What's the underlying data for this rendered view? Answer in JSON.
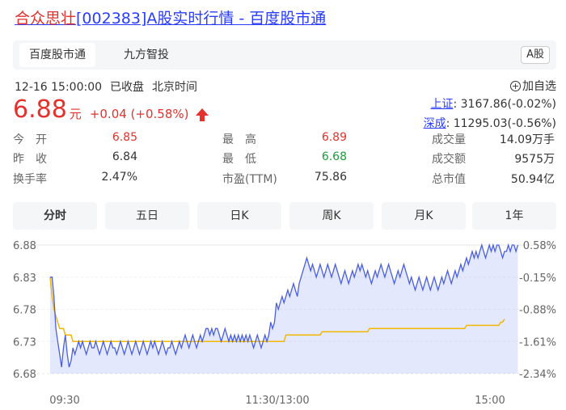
{
  "title": {
    "name": "合众思壮",
    "rest": "[002383]A股实时行情 - 百度股市通"
  },
  "tabs": {
    "t1": "百度股市通",
    "t2": "九方智投",
    "badge": "A股"
  },
  "status": {
    "datetime": "12-16 15:00:00",
    "state": "已收盘",
    "tz": "北京时间"
  },
  "add_fav": "加自选",
  "price": {
    "last": "6.88",
    "unit": "元",
    "change": "+0.04 (+0.58%)"
  },
  "indices": [
    {
      "name": "上证",
      "value": ": 3167.86(-0.02%)"
    },
    {
      "name": "深成",
      "value": ": 11295.03(-0.56%)"
    }
  ],
  "stats": [
    [
      {
        "label": "今　开",
        "value": "6.85"
      },
      {
        "label": "最　高",
        "value": "6.89"
      },
      {
        "label": "成交量",
        "value": "14.09万手"
      }
    ],
    [
      {
        "label": "昨　收",
        "value": "6.84"
      },
      {
        "label": "最　低",
        "value": "6.68"
      },
      {
        "label": "成交额",
        "value": "9575万"
      }
    ],
    [
      {
        "label": "换手率",
        "value": "2.47%"
      },
      {
        "label": "市盈(TTM)",
        "value": "75.86"
      },
      {
        "label": "总市值",
        "value": "50.94亿"
      }
    ]
  ],
  "period_tabs": [
    "分时",
    "五日",
    "日K",
    "周K",
    "月K",
    "1年"
  ],
  "colors": {
    "up": "#e4312c",
    "down": "#1b9c3a",
    "link": "#2a3cff",
    "price_line": "#4a5fe0",
    "avg_line": "#f2b705"
  },
  "chart_data": {
    "type": "line",
    "y_left_ticks": [
      "6.88",
      "6.83",
      "6.78",
      "6.73",
      "6.68"
    ],
    "y_right_ticks": [
      "0.58%",
      "-0.15%",
      "-0.88%",
      "-1.61%",
      "-2.34%"
    ],
    "x_ticks": [
      "09:30",
      "11:30/13:00",
      "15:00"
    ],
    "ylim": [
      6.68,
      6.88
    ],
    "x_points": 240,
    "series": [
      {
        "values": [
          6.83,
          6.83,
          6.8,
          6.75,
          6.73,
          6.71,
          6.69,
          6.72,
          6.74,
          6.71,
          6.69,
          6.7,
          6.72,
          6.71,
          6.72,
          6.73,
          6.72,
          6.73,
          6.72,
          6.71,
          6.72,
          6.73,
          6.72,
          6.72,
          6.73,
          6.72,
          6.71,
          6.72,
          6.73,
          6.72,
          6.71,
          6.72,
          6.73,
          6.72,
          6.72,
          6.71,
          6.72,
          6.73,
          6.72,
          6.71,
          6.72,
          6.73,
          6.72,
          6.71,
          6.72,
          6.73,
          6.72,
          6.71,
          6.72,
          6.73,
          6.72,
          6.71,
          6.72,
          6.73,
          6.72,
          6.73,
          6.72,
          6.71,
          6.72,
          6.73,
          6.72,
          6.71,
          6.72,
          6.72,
          6.73,
          6.72,
          6.71,
          6.72,
          6.73,
          6.72,
          6.73,
          6.74,
          6.73,
          6.72,
          6.73,
          6.74,
          6.73,
          6.72,
          6.73,
          6.74,
          6.73,
          6.74,
          6.75,
          6.75,
          6.74,
          6.75,
          6.74,
          6.75,
          6.75,
          6.74,
          6.73,
          6.74,
          6.75,
          6.74,
          6.73,
          6.74,
          6.73,
          6.74,
          6.73,
          6.74,
          6.73,
          6.74,
          6.73,
          6.74,
          6.73,
          6.74,
          6.73,
          6.72,
          6.73,
          6.74,
          6.73,
          6.72,
          6.73,
          6.74,
          6.73,
          6.74,
          6.76,
          6.75,
          6.76,
          6.79,
          6.78,
          6.79,
          6.8,
          6.79,
          6.8,
          6.81,
          6.8,
          6.81,
          6.82,
          6.81,
          6.8,
          6.82,
          6.83,
          6.84,
          6.85,
          6.86,
          6.85,
          6.84,
          6.85,
          6.84,
          6.83,
          6.84,
          6.85,
          6.84,
          6.83,
          6.84,
          6.85,
          6.84,
          6.83,
          6.84,
          6.85,
          6.84,
          6.83,
          6.82,
          6.83,
          6.84,
          6.83,
          6.82,
          6.83,
          6.84,
          6.83,
          6.84,
          6.85,
          6.84,
          6.85,
          6.84,
          6.83,
          6.84,
          6.83,
          6.82,
          6.83,
          6.84,
          6.83,
          6.84,
          6.85,
          6.84,
          6.83,
          6.84,
          6.85,
          6.84,
          6.83,
          6.82,
          6.83,
          6.84,
          6.83,
          6.84,
          6.85,
          6.84,
          6.83,
          6.82,
          6.83,
          6.82,
          6.81,
          6.82,
          6.83,
          6.82,
          6.81,
          6.82,
          6.83,
          6.82,
          6.81,
          6.82,
          6.83,
          6.82,
          6.81,
          6.82,
          6.83,
          6.82,
          6.83,
          6.84,
          6.83,
          6.82,
          6.83,
          6.84,
          6.83,
          6.84,
          6.85,
          6.84,
          6.85,
          6.86,
          6.85,
          6.86,
          6.87,
          6.86,
          6.87,
          6.86,
          6.87,
          6.88,
          6.87,
          6.86,
          6.87,
          6.88,
          6.87,
          6.88,
          6.87,
          6.88,
          6.88,
          6.87,
          6.86,
          6.87,
          6.87,
          6.88,
          6.87,
          6.88,
          6.88,
          6.87,
          6.88
        ]
      },
      {
        "values": [
          6.83,
          6.8,
          6.78,
          6.77,
          6.76,
          6.75,
          6.75,
          6.75,
          6.74,
          6.74,
          6.74,
          6.74,
          6.73,
          6.73,
          6.73,
          6.73,
          6.73,
          6.73,
          6.73,
          6.73,
          6.73,
          6.73,
          6.73,
          6.73,
          6.73,
          6.73,
          6.73,
          6.73,
          6.73,
          6.73,
          6.73,
          6.73,
          6.73,
          6.73,
          6.73,
          6.73,
          6.73,
          6.73,
          6.73,
          6.73,
          6.73,
          6.73,
          6.73,
          6.73,
          6.73,
          6.73,
          6.73,
          6.73,
          6.73,
          6.73,
          6.73,
          6.73,
          6.73,
          6.73,
          6.73,
          6.73,
          6.73,
          6.73,
          6.73,
          6.73,
          6.73,
          6.73,
          6.73,
          6.73,
          6.73,
          6.73,
          6.73,
          6.73,
          6.73,
          6.73,
          6.73,
          6.73,
          6.73,
          6.73,
          6.73,
          6.73,
          6.73,
          6.73,
          6.73,
          6.73,
          6.73,
          6.73,
          6.73,
          6.73,
          6.73,
          6.73,
          6.73,
          6.73,
          6.73,
          6.73,
          6.73,
          6.73,
          6.73,
          6.73,
          6.73,
          6.73,
          6.73,
          6.73,
          6.73,
          6.73,
          6.73,
          6.73,
          6.73,
          6.73,
          6.73,
          6.73,
          6.73,
          6.73,
          6.73,
          6.73,
          6.73,
          6.73,
          6.73,
          6.73,
          6.73,
          6.73,
          6.73,
          6.73,
          6.73,
          6.73,
          6.73,
          6.73,
          6.73,
          6.73,
          6.74,
          6.74,
          6.74,
          6.74,
          6.74,
          6.74,
          6.74,
          6.74,
          6.74,
          6.74,
          6.74,
          6.74,
          6.74,
          6.74,
          6.74,
          6.74,
          6.74,
          6.74,
          6.74,
          6.745,
          6.745,
          6.745,
          6.745,
          6.745,
          6.745,
          6.745,
          6.745,
          6.745,
          6.745,
          6.745,
          6.745,
          6.745,
          6.745,
          6.745,
          6.745,
          6.745,
          6.745,
          6.745,
          6.745,
          6.745,
          6.745,
          6.745,
          6.745,
          6.745,
          6.75,
          6.75,
          6.75,
          6.75,
          6.75,
          6.75,
          6.75,
          6.75,
          6.75,
          6.75,
          6.75,
          6.75,
          6.75,
          6.75,
          6.75,
          6.75,
          6.75,
          6.75,
          6.75,
          6.75,
          6.75,
          6.75,
          6.75,
          6.75,
          6.75,
          6.75,
          6.75,
          6.75,
          6.75,
          6.75,
          6.75,
          6.75,
          6.75,
          6.75,
          6.75,
          6.75,
          6.75,
          6.75,
          6.75,
          6.75,
          6.75,
          6.75,
          6.75,
          6.75,
          6.75,
          6.75,
          6.75,
          6.75,
          6.75,
          6.75,
          6.75,
          6.755,
          6.755,
          6.755,
          6.755,
          6.755,
          6.755,
          6.755,
          6.755,
          6.755,
          6.755,
          6.755,
          6.755,
          6.755,
          6.755,
          6.755,
          6.755,
          6.755,
          6.755,
          6.76,
          6.76,
          6.765
        ]
      }
    ]
  }
}
